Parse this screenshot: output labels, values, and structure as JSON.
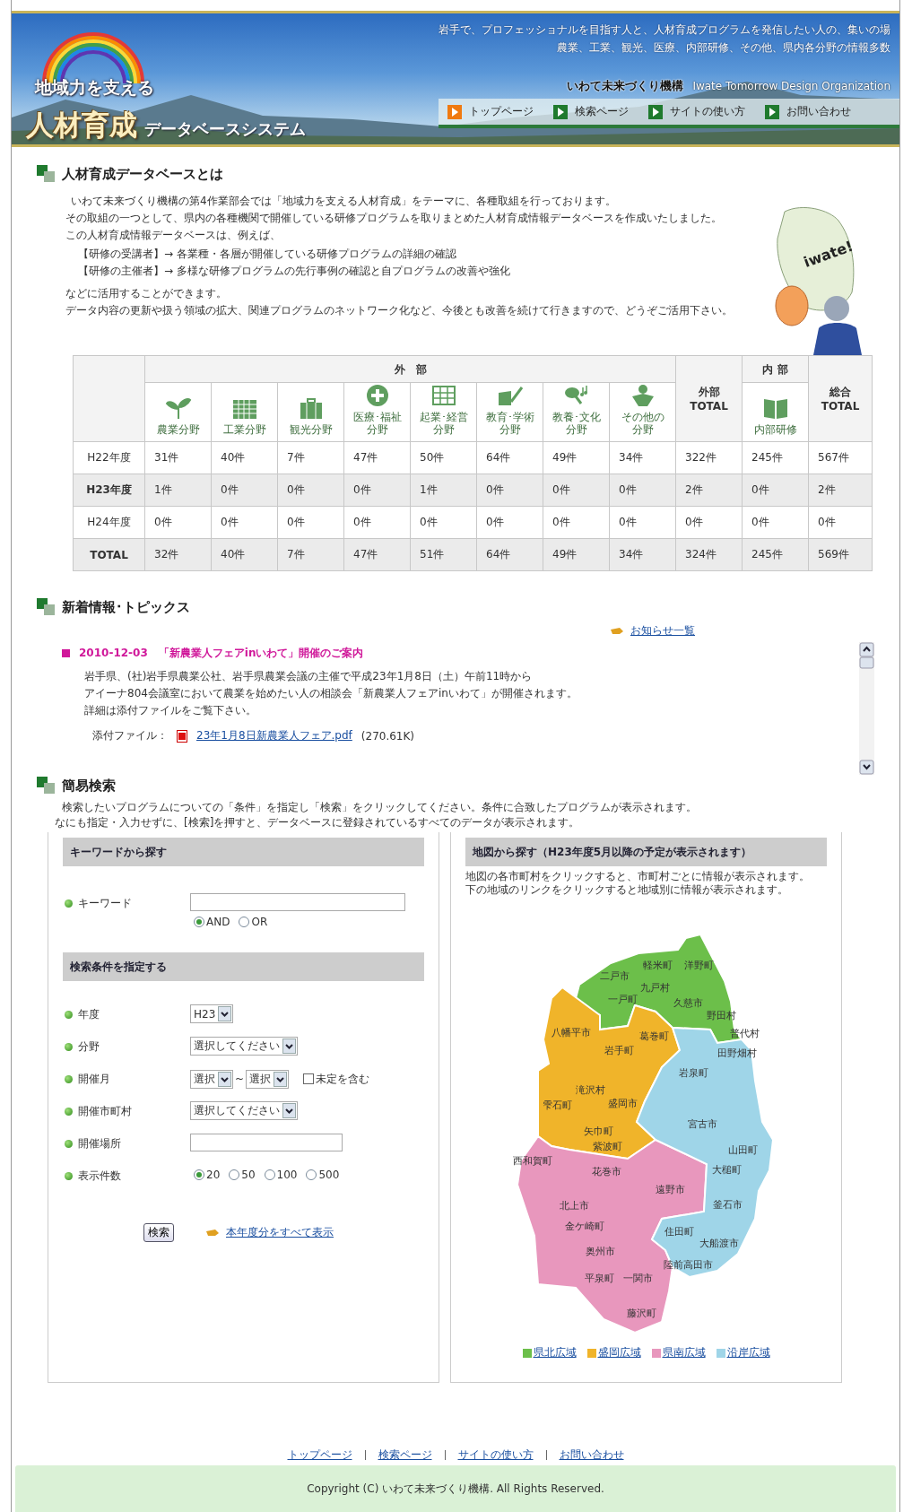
{
  "header": {
    "tagline": [
      "岩手で、プロフェッショナルを目指す人と、人材育成プログラムを発信したい人の、集いの場",
      "農業、工業、観光、医療、内部研修、その他、県内各分野の情報多数"
    ],
    "subtitle": "地域力を支える",
    "title": "人材育成",
    "system": "データベースシステム",
    "org": "いわて未来づくり機構",
    "org_en": "Iwate Tomorrow Design Organization",
    "nav": [
      {
        "label": "トップページ",
        "selected": true
      },
      {
        "label": "検索ページ",
        "selected": false
      },
      {
        "label": "サイトの使い方",
        "selected": false
      },
      {
        "label": "お問い合わせ",
        "selected": false
      }
    ]
  },
  "about": {
    "title": "人材育成データベースとは",
    "paragraphs": [
      "いわて未来づくり機構の第4作業部会では「地域力を支える人材育成」をテーマに、各種取組を行っております。",
      "その取組の一つとして、県内の各種機関で開催している研修プログラムを取りまとめた人材育成情報データベースを作成いたしました。",
      "この人材育成情報データベースは、例えば、"
    ],
    "roles": [
      "【研修の受講者】→ 各業種・各層が開催している研修プログラムの詳細の確認",
      "【研修の主催者】→ 多様な研修プログラムの先行事例の確認と自プログラムの改善や強化"
    ],
    "closing": [
      "などに活用することができます。",
      "データ内容の更新や扱う領域の拡大、関連プログラムのネットワーク化など、今後とも改善を続けて行きますので、どうぞご活用下さい。"
    ],
    "mascot_text": "iwate!",
    "table": {
      "outer_group": "外　部",
      "outer_total": [
        "外部",
        "TOTAL"
      ],
      "inner_group": "内 部",
      "grand_total": [
        "総合",
        "TOTAL"
      ],
      "categories": [
        [
          "農業分野"
        ],
        [
          "工業分野"
        ],
        [
          "観光分野"
        ],
        [
          "医療･福祉",
          "分野"
        ],
        [
          "起業･経営",
          "分野"
        ],
        [
          "教育･学術",
          "分野"
        ],
        [
          "教養･文化",
          "分野"
        ],
        [
          "その他の",
          "分野"
        ]
      ],
      "inner_category": "内部研修",
      "rows": [
        {
          "label": "H22年度",
          "highlighted": false,
          "cells": [
            "31件",
            "40件",
            "7件",
            "47件",
            "50件",
            "64件",
            "49件",
            "34件",
            "322件",
            "245件",
            "567件"
          ]
        },
        {
          "label": "H23年度",
          "highlighted": true,
          "cells": [
            "1件",
            "0件",
            "0件",
            "0件",
            "1件",
            "0件",
            "0件",
            "0件",
            "2件",
            "0件",
            "2件"
          ]
        },
        {
          "label": "H24年度",
          "highlighted": false,
          "cells": [
            "0件",
            "0件",
            "0件",
            "0件",
            "0件",
            "0件",
            "0件",
            "0件",
            "0件",
            "0件",
            "0件"
          ]
        },
        {
          "label": "TOTAL",
          "highlighted": true,
          "cells": [
            "32件",
            "40件",
            "7件",
            "47件",
            "51件",
            "64件",
            "49件",
            "34件",
            "324件",
            "245件",
            "569件"
          ]
        }
      ]
    }
  },
  "news": {
    "title": "新着情報･トピックス",
    "list_link": "お知らせ一覧",
    "items": [
      {
        "date": "2010-12-03",
        "title": "「新農業人フェアinいわて」開催のご案内",
        "body": [
          "岩手県、(社)岩手県農業公社、岩手県農業会議の主催で平成23年1月8日（土）午前11時から",
          "アイーナ804会議室において農業を始めたい人の相談会「新農業人フェアinいわて」が開催されます。",
          "詳細は添付ファイルをご覧下さい。"
        ],
        "attachment_label": "添付ファイル：",
        "attachment": "23年1月8日新農業人フェア.pdf",
        "size": "(270.61K)"
      }
    ]
  },
  "search": {
    "title": "簡易検索",
    "intro": [
      "検索したいプログラムについての「条件」を指定し「検索」をクリックしてください。条件に合致したプログラムが表示されます。",
      "なにも指定・入力せずに、[検索]を押すと、データベースに登録されているすべてのデータが表示されます。"
    ],
    "keyword": {
      "title": "キーワードから探す",
      "label": "キーワード",
      "options": [
        {
          "label": "AND",
          "selected": true
        },
        {
          "label": "OR",
          "selected": false
        }
      ]
    },
    "conditions": {
      "title": "検索条件を指定する",
      "fields": [
        {
          "kind": "select",
          "label": "年度",
          "value": "H23"
        },
        {
          "kind": "select",
          "label": "分野",
          "value": "選択してください"
        },
        {
          "kind": "range",
          "label": "開催月",
          "from": "選択",
          "separator": "~",
          "to": "選択",
          "check": {
            "label": "未定を含む",
            "checked": false
          }
        },
        {
          "kind": "select",
          "label": "開催市町村",
          "value": "選択してください"
        },
        {
          "kind": "text",
          "label": "開催場所"
        },
        {
          "kind": "radios",
          "label": "表示件数",
          "options": [
            {
              "label": "20",
              "selected": true
            },
            {
              "label": "50",
              "selected": false
            },
            {
              "label": "100",
              "selected": false
            },
            {
              "label": "500",
              "selected": false
            }
          ]
        }
      ]
    },
    "submit": "検索",
    "show_all": "本年度分をすべて表示",
    "map": {
      "title": "地図から探す（H23年度5月以降の予定が表示されます）",
      "intro": [
        "地図の各市町村をクリックすると、市町村ごとに情報が表示されます。",
        "下の地域のリンクをクリックすると地域別に情報が表示されます。"
      ],
      "regions": [
        {
          "name": "県北広域",
          "color": "#6cbf4a",
          "towns": [
            "二戸市",
            "軽米町",
            "洋野町",
            "九戸村",
            "一戸町",
            "久慈市",
            "野田村",
            "普代村"
          ]
        },
        {
          "name": "盛岡広域",
          "color": "#f0b42a",
          "towns": [
            "八幡平市",
            "葛巻町",
            "岩手町",
            "滝沢村",
            "雫石町",
            "盛岡市",
            "矢巾町",
            "紫波町"
          ]
        },
        {
          "name": "県南広域",
          "color": "#e897bd",
          "towns": [
            "西和賀町",
            "花巻市",
            "遠野市",
            "北上市",
            "金ケ崎町",
            "奥州市",
            "平泉町",
            "一関市",
            "藤沢町"
          ]
        },
        {
          "name": "沿岸広域",
          "color": "#9fd5e8",
          "towns": [
            "田野畑村",
            "岩泉町",
            "宮古市",
            "山田町",
            "大槌町",
            "釜石市",
            "住田町",
            "大船渡市",
            "陸前高田市"
          ]
        }
      ]
    }
  },
  "footer": {
    "links": [
      "トップページ",
      "検索ページ",
      "サイトの使い方",
      "お問い合わせ"
    ],
    "copyright": "Copyright (C) いわて未来づくり機構. All Rights Reserved."
  }
}
